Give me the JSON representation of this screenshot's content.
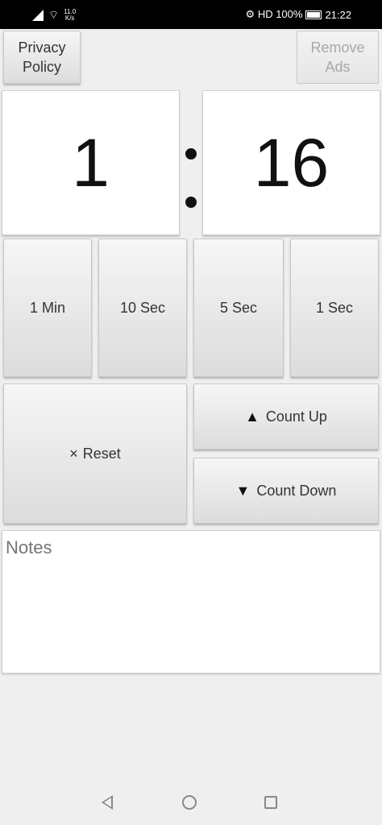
{
  "status_bar": {
    "speed_value": "11.0",
    "speed_unit": "K/s",
    "right_text": "⚙ HD 100% ",
    "time": "21:22"
  },
  "top_buttons": {
    "privacy_policy": "Privacy Policy",
    "remove_ads": "Remove Ads"
  },
  "timer": {
    "minutes": "1",
    "seconds": "16"
  },
  "increments": {
    "one_min": "1 Min",
    "ten_sec": "10 Sec",
    "five_sec": "5 Sec",
    "one_sec": "1 Sec"
  },
  "controls": {
    "reset_icon": "×",
    "reset_label": "Reset",
    "count_up_icon": "▲",
    "count_up_label": "Count Up",
    "count_down_icon": "▼",
    "count_down_label": "Count Down"
  },
  "notes": {
    "placeholder": "Notes"
  },
  "icons": {
    "back": "back-icon",
    "home": "home-icon",
    "recents": "recents-icon"
  }
}
